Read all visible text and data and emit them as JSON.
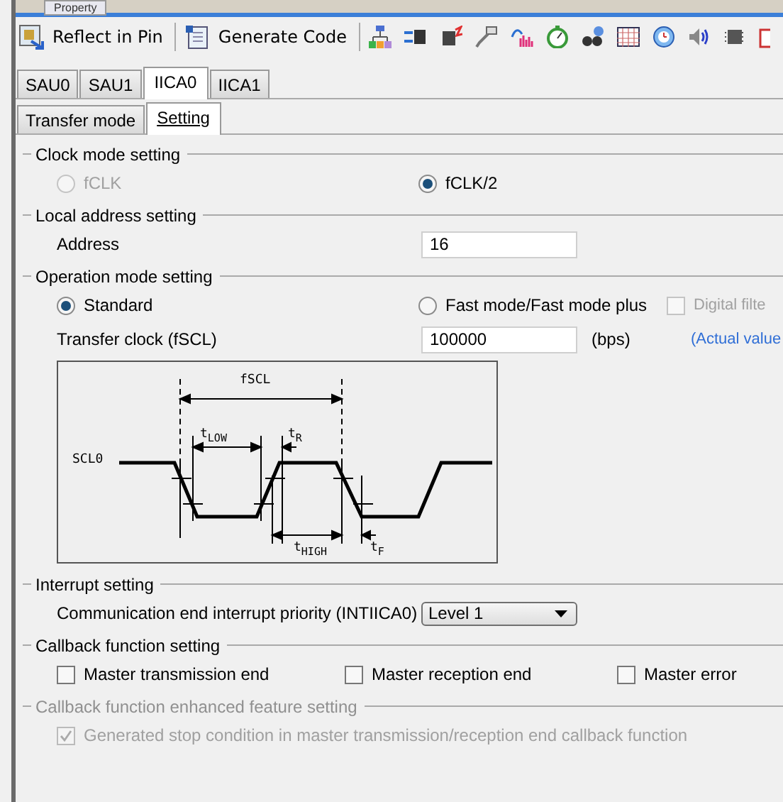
{
  "top_tab": {
    "label": "Property"
  },
  "toolbar": {
    "buttons": [
      {
        "label": "Reflect in Pin",
        "kind": "reflect"
      },
      {
        "label": "Generate Code",
        "kind": "generate"
      }
    ]
  },
  "tabs": [
    {
      "label": "SAU0",
      "selected": false
    },
    {
      "label": "SAU1",
      "selected": false
    },
    {
      "label": "IICA0",
      "selected": true
    },
    {
      "label": "IICA1",
      "selected": false
    }
  ],
  "subtabs": [
    {
      "label": "Transfer mode",
      "selected": false
    },
    {
      "label": "Setting",
      "selected": true
    }
  ],
  "clock_mode": {
    "title": "Clock mode setting",
    "options": [
      {
        "label": "fCLK",
        "selected": false,
        "disabled": true
      },
      {
        "label": "fCLK/2",
        "selected": true,
        "disabled": false
      }
    ]
  },
  "local_address": {
    "title": "Local address setting",
    "label": "Address",
    "value": "16"
  },
  "operation_mode": {
    "title": "Operation mode setting",
    "options": [
      {
        "label": "Standard",
        "selected": true
      },
      {
        "label": "Fast mode/Fast mode plus",
        "selected": false
      }
    ],
    "digital_filter": {
      "label": "Digital filte",
      "checked": false,
      "disabled": true
    },
    "transfer_clock": {
      "label": "Transfer clock (fSCL)",
      "value": "100000",
      "unit": "(bps)",
      "link": "(Actual value"
    },
    "diagram": {
      "labels": [
        {
          "text": "fSCL",
          "kind": "fscl"
        },
        {
          "text": "t$_{LOW}$",
          "kind": "tlow"
        },
        {
          "text": "t$_{R}$",
          "kind": "tr"
        },
        {
          "text": "SCL0",
          "kind": "signal"
        },
        {
          "text": "t$_{HIGH}$",
          "kind": "thigh"
        },
        {
          "text": "t$_{F}$",
          "kind": "tf"
        }
      ]
    }
  },
  "interrupt": {
    "title": "Interrupt setting",
    "label": "Communication end interrupt priority (INTIICA0)",
    "value": "Level 1"
  },
  "callback": {
    "title": "Callback function setting",
    "options": [
      {
        "label": "Master transmission end",
        "checked": false
      },
      {
        "label": "Master reception end",
        "checked": false
      },
      {
        "label": "Master error",
        "checked": false
      }
    ]
  },
  "enhanced": {
    "title": "Callback function enhanced feature setting",
    "disabled": true,
    "option": {
      "label": "Generated stop condition in master transmission/reception end callback function",
      "checked": true,
      "disabled": true
    }
  }
}
